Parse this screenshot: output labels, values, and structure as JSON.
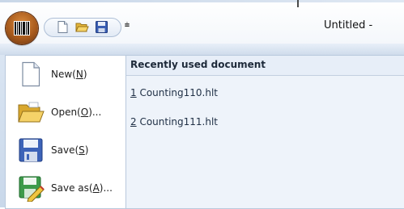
{
  "title_bar": {
    "window_title": "Untitled -",
    "quick_access": {
      "new_icon": "new-document-icon",
      "open_icon": "open-folder-icon",
      "save_icon": "floppy-disk-icon",
      "customize_glyph": "⩧"
    }
  },
  "app_button": {
    "icon": "barcode-icon"
  },
  "menu": {
    "items": [
      {
        "label": "New(",
        "access_key": "N",
        "label_end": ")",
        "icon": "new-document-icon"
      },
      {
        "label": "Open(",
        "access_key": "O",
        "label_end": ")...",
        "icon": "open-folder-icon"
      },
      {
        "label": "Save(",
        "access_key": "S",
        "label_end": ")",
        "icon": "floppy-disk-icon"
      },
      {
        "label": "Save as(",
        "access_key": "A",
        "label_end": ")...",
        "icon": "save-as-icon"
      }
    ],
    "recent": {
      "header": "Recently used document",
      "documents": [
        {
          "number": "1",
          "name": " Counting110.hlt"
        },
        {
          "number": "2",
          "name": " Counting111.hlt"
        }
      ]
    }
  }
}
